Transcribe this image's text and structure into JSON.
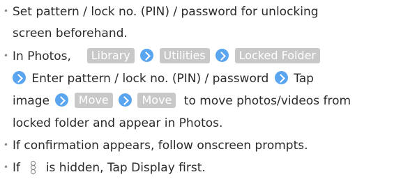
{
  "bullet_char": "・",
  "lines": {
    "l1": "Set pattern / lock no. (PIN) / password for unlocking",
    "l2": "screen beforehand.",
    "l3_a": "In Photos,",
    "l3_tag1": "Library",
    "l3_tag2": "Utilities",
    "l3_tag3": "Locked Folder",
    "l4_a": "Enter pattern / lock no. (PIN) / password",
    "l4_b": "Tap",
    "l5_a": "image",
    "l5_tag1": "Move",
    "l5_tag2": "Move",
    "l5_b": "to move photos/videos from",
    "l6": "locked folder and appear in Photos.",
    "l7": "If confirmation appears, follow onscreen prompts.",
    "l8_a": "If",
    "l8_b": "is hidden, Tap Display first."
  },
  "icons": {
    "arrow": "arrow-right-circle-icon",
    "more": "more-vertical-icon"
  },
  "colors": {
    "text": "#2b2b2b",
    "tag_bg": "#c8c8c8",
    "tag_text": "#ffffff",
    "arrow": "#5aa5f0"
  }
}
